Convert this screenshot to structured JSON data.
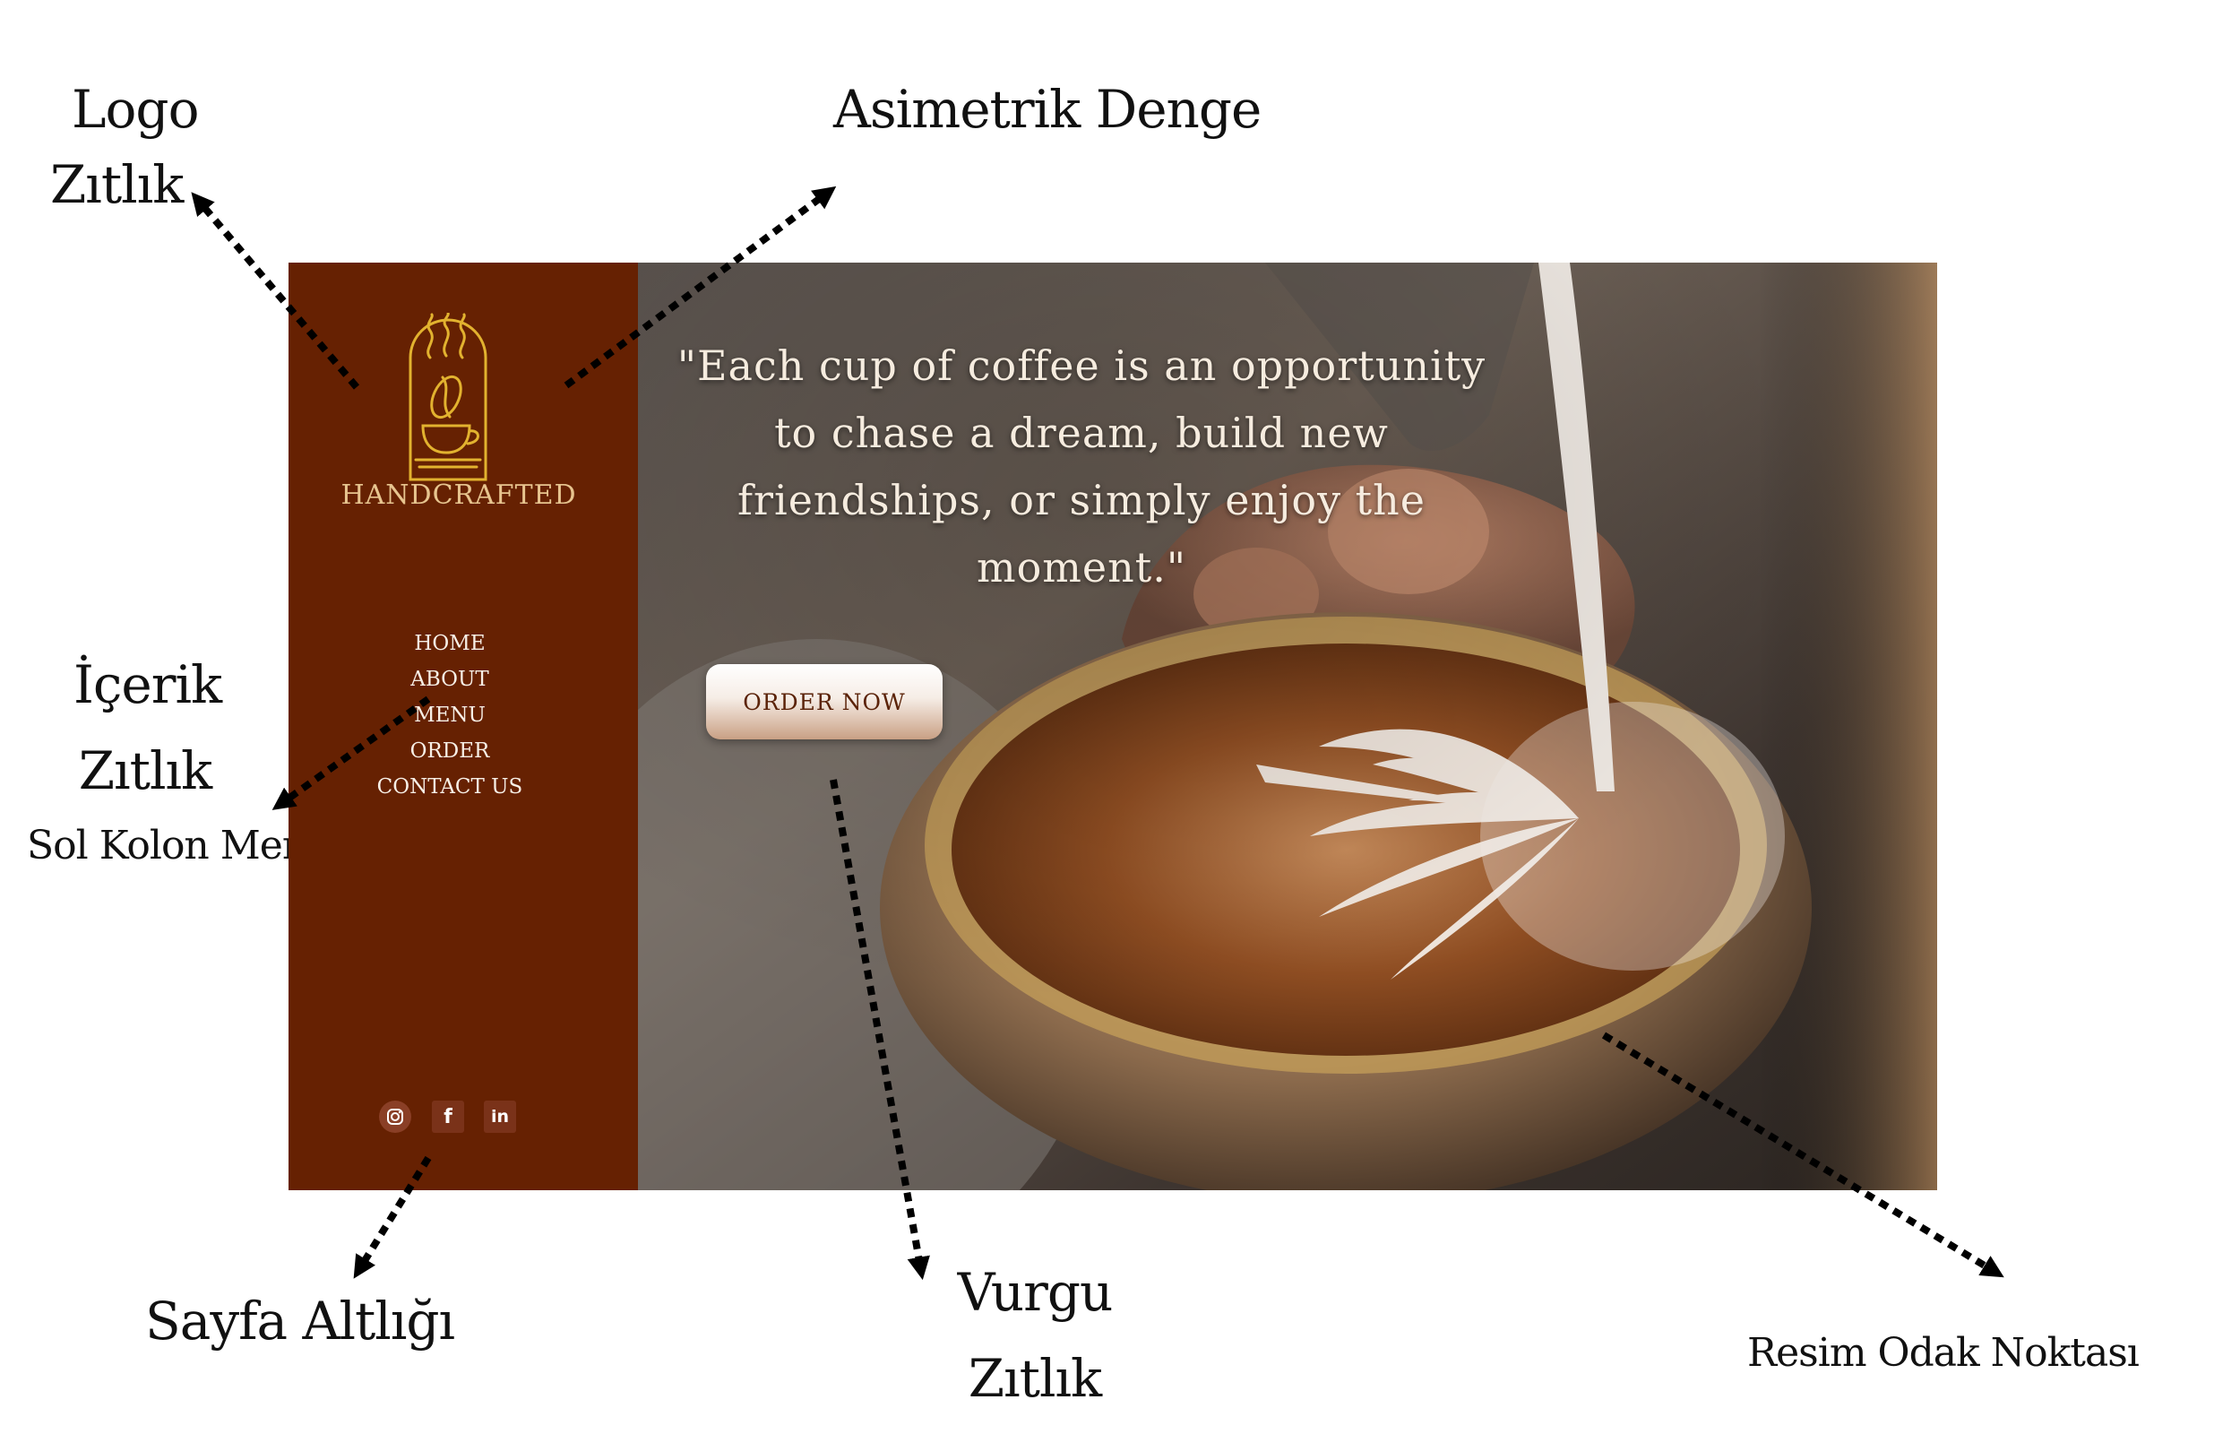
{
  "annotations": {
    "logo": "Logo",
    "logo_contrast": "Zıtlık",
    "asymmetric": "Asimetrik Denge",
    "content": "İçerik",
    "content_contrast": "Zıtlık",
    "left_menu": "Sol Kolon Menü",
    "footer": "Sayfa Altlığı",
    "emphasis": "Vurgu",
    "emphasis_contrast": "Zıtlık",
    "focal_point": "Resim Odak Noktası"
  },
  "site": {
    "brand": "HANDCRAFTED",
    "nav": [
      "HOME",
      "ABOUT",
      "MENU",
      "ORDER",
      "CONTACT US"
    ],
    "quote": "\"Each cup of coffee is an opportunity to chase a dream, build new friendships, or simply enjoy the moment.\"",
    "cta": "ORDER NOW",
    "social": {
      "instagram_icon": "instagram-icon",
      "facebook_label": "f",
      "linkedin_label": "in"
    }
  },
  "colors": {
    "sidebar": "#662102",
    "brand_gold": "#e7c48f",
    "logo_stroke": "#e2b22f",
    "cta_text": "#5b2309",
    "arrow": "#000000"
  }
}
